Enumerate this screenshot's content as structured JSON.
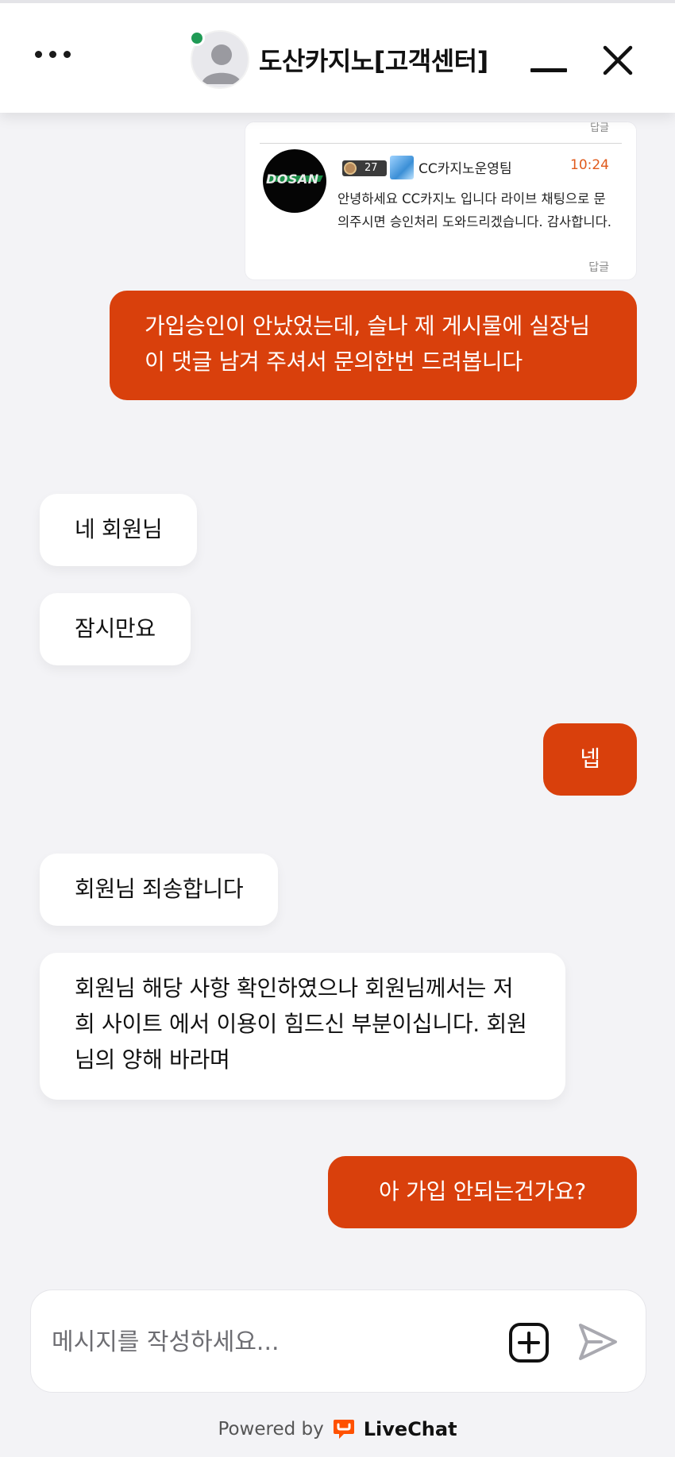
{
  "header": {
    "title": "도산카지노[고객센터]",
    "menu_icon": "more-dots-icon",
    "minimize_icon": "minimize-icon",
    "close_icon": "close-icon",
    "status_color": "#1f9a55"
  },
  "shared_screenshot": {
    "top_reply_label": "답글",
    "logo_text": "DOSAN",
    "level": "27",
    "team_name": "CC카지노운영팀",
    "time": "10:24",
    "message": "안녕하세요 CC카지노 입니다 라이브 채팅으로 문의주시면 승인처리 도와드리겠습니다. 감사합니다.",
    "bottom_reply_label": "답글"
  },
  "messages": [
    {
      "from": "visitor",
      "text": "가입승인이 안났었는데, 슬나 제 게시물에 실장님이 댓글 남겨 주셔서 문의한번 드려봅니다"
    },
    {
      "from": "agent",
      "text": "네 회원님"
    },
    {
      "from": "agent",
      "text": "잠시만요"
    },
    {
      "from": "visitor",
      "text": "넵"
    },
    {
      "from": "agent",
      "text": "회원님 죄송합니다"
    },
    {
      "from": "agent",
      "text": "회원님 해당 사항 확인하였으나 회원님께서는 저희 사이트 에서 이용이 힘드신 부분이십니다. 회원님의 양해 바라며"
    },
    {
      "from": "visitor",
      "text": "아 가입 안되는건가요?"
    }
  ],
  "composer": {
    "placeholder": "메시지를 작성하세요...",
    "value": "",
    "attach_icon": "add-attachment-icon",
    "send_icon": "send-icon"
  },
  "footer": {
    "powered_by": "Powered by",
    "brand": "LiveChat",
    "brand_color": "#ff5100"
  },
  "colors": {
    "accent": "#d9400c",
    "background": "#f3f3f6"
  }
}
